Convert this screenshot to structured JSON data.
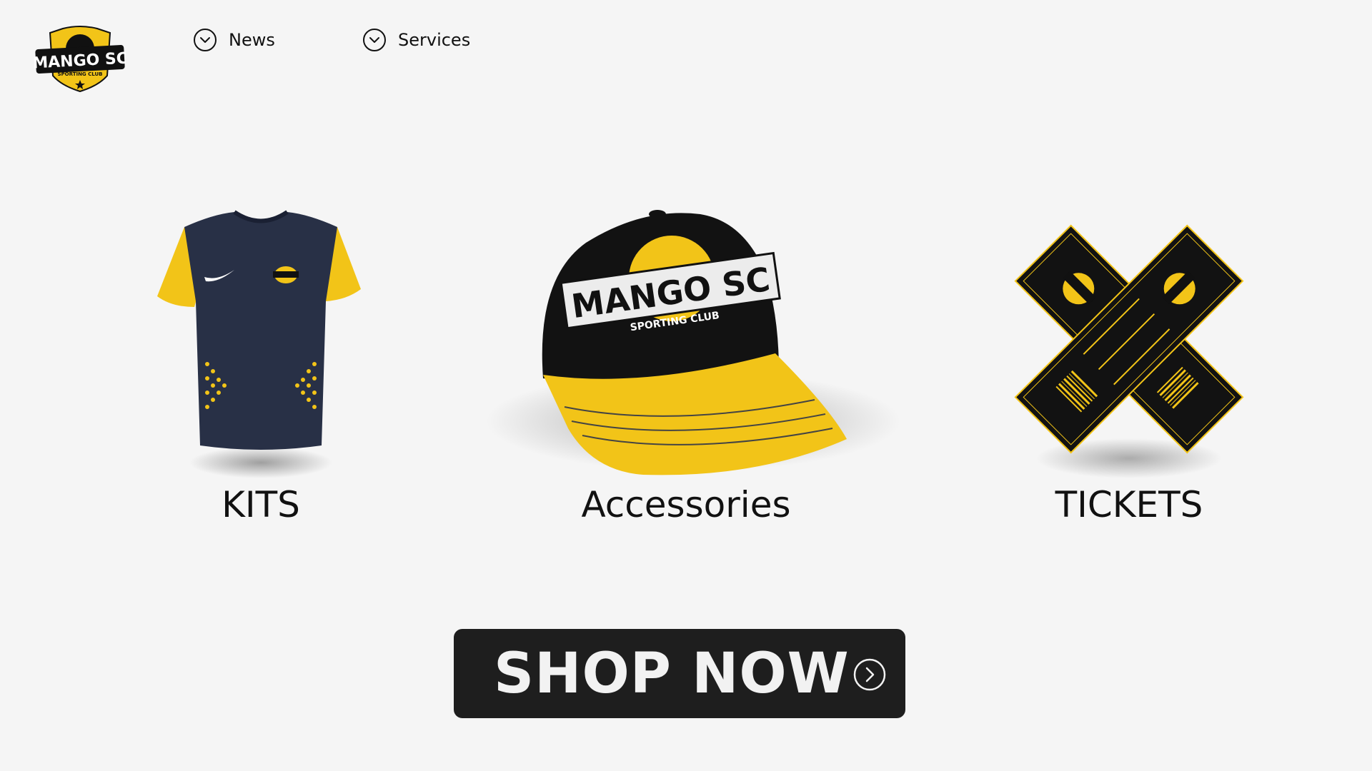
{
  "brand": {
    "logo_main_text": "MANGO SC",
    "logo_sub_text": "SPORTING CLUB",
    "accent_color": "#f2c418",
    "dark_color": "#111111"
  },
  "nav": {
    "items": [
      {
        "label": "News",
        "icon": "chevron-down-circle-icon"
      },
      {
        "label": "Services",
        "icon": "chevron-down-circle-icon"
      }
    ]
  },
  "categories": [
    {
      "label": "KITS",
      "image": "jersey-image"
    },
    {
      "label": "Accessories",
      "image": "cap-image"
    },
    {
      "label": "TICKETS",
      "image": "tickets-image"
    }
  ],
  "cta": {
    "label": "SHOP NOW",
    "icon": "chevron-right-circle-icon"
  }
}
